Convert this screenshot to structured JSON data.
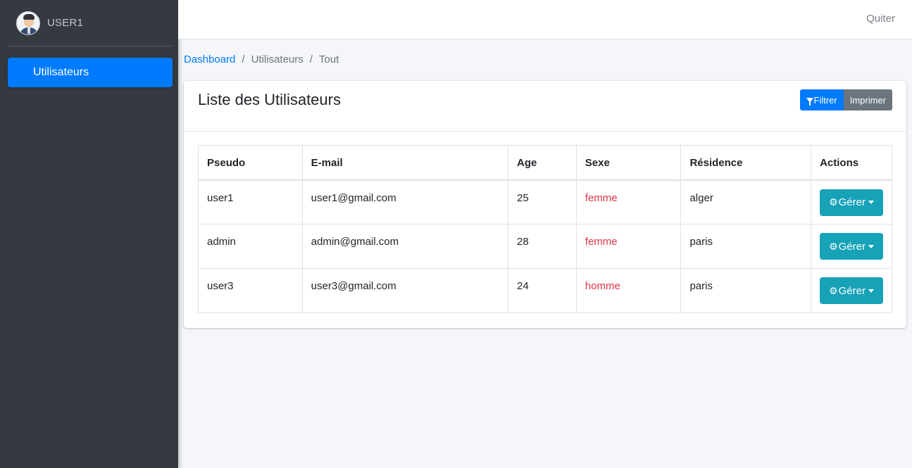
{
  "sidebar": {
    "user_name": "USER1",
    "items": [
      {
        "label": "Utilisateurs",
        "active": true
      }
    ]
  },
  "topbar": {
    "quit_label": "Quiter"
  },
  "breadcrumb": [
    "Dashboard",
    "Utilisateurs",
    "Tout"
  ],
  "card": {
    "title": "Liste des Utilisateurs",
    "filter_label": "Filtrer",
    "print_label": "Imprimer"
  },
  "table": {
    "columns": [
      "Pseudo",
      "E-mail",
      "Age",
      "Sexe",
      "Résidence",
      "Actions"
    ],
    "manage_label": "Gérer",
    "rows": [
      {
        "pseudo": "user1",
        "email": "user1@gmail.com",
        "age": "25",
        "sexe": "femme",
        "residence": "alger"
      },
      {
        "pseudo": "admin",
        "email": "admin@gmail.com",
        "age": "28",
        "sexe": "femme",
        "residence": "paris"
      },
      {
        "pseudo": "user3",
        "email": "user3@gmail.com",
        "age": "24",
        "sexe": "homme",
        "residence": "paris"
      }
    ]
  },
  "colors": {
    "primary": "#007bff",
    "secondary": "#6c757d",
    "info": "#17a2b8",
    "danger": "#dc3545",
    "sidebar": "#343a40"
  },
  "icons": [
    "user-avatar",
    "filter-icon",
    "gear-icon",
    "caret-down-icon"
  ]
}
